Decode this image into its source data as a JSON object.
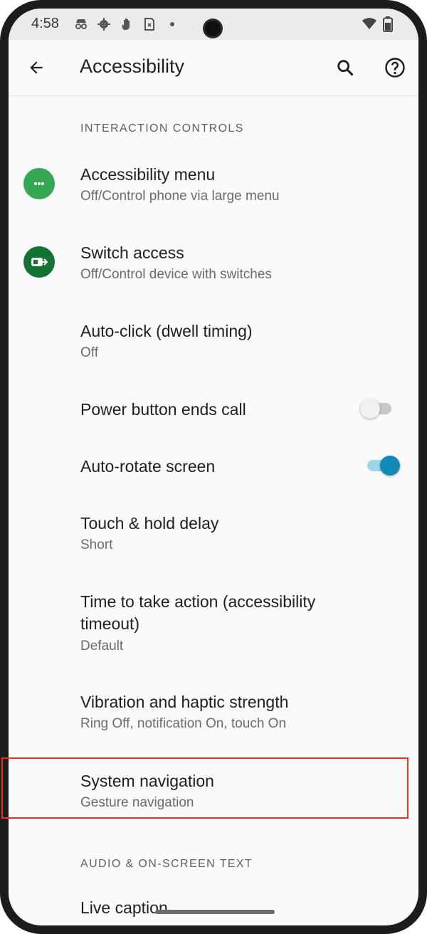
{
  "status_bar": {
    "time": "4:58",
    "icons": [
      "incognito-icon",
      "settings-icon",
      "hand-icon",
      "sim-icon",
      "dot-icon"
    ],
    "right_icons": [
      "wifi-icon",
      "battery-icon"
    ]
  },
  "app_bar": {
    "title": "Accessibility",
    "back_icon": "back-arrow-icon",
    "search_icon": "search-icon",
    "help_icon": "help-icon"
  },
  "sections": {
    "interaction_controls": "INTERACTION CONTROLS",
    "audio_onscreen_text": "AUDIO & ON-SCREEN TEXT"
  },
  "items": [
    {
      "title": "Accessibility menu",
      "subtitle": "Off/Control phone via large menu",
      "icon": "accessibility-menu-icon",
      "icon_color": "#34a853"
    },
    {
      "title": "Switch access",
      "subtitle": "Off/Control device with switches",
      "icon": "switch-access-icon",
      "icon_color": "#137333"
    },
    {
      "title": "Auto-click (dwell timing)",
      "subtitle": "Off"
    },
    {
      "title": "Power button ends call",
      "toggle": false
    },
    {
      "title": "Auto-rotate screen",
      "toggle": true
    },
    {
      "title": "Touch & hold delay",
      "subtitle": "Short"
    },
    {
      "title_line1": "Time to take action (accessibility",
      "title_line2": "timeout)",
      "subtitle": "Default"
    },
    {
      "title": "Vibration and haptic strength",
      "subtitle": "Ring Off, notification On, touch On"
    },
    {
      "title": "System navigation",
      "subtitle": "Gesture navigation",
      "highlighted": true
    },
    {
      "title": "Live caption"
    }
  ],
  "colors": {
    "accent": "#0f8ab8",
    "highlight_border": "#e8341c",
    "toggle_off_track": "#c8c8c8",
    "toggle_on_track": "#9fd6e8"
  }
}
